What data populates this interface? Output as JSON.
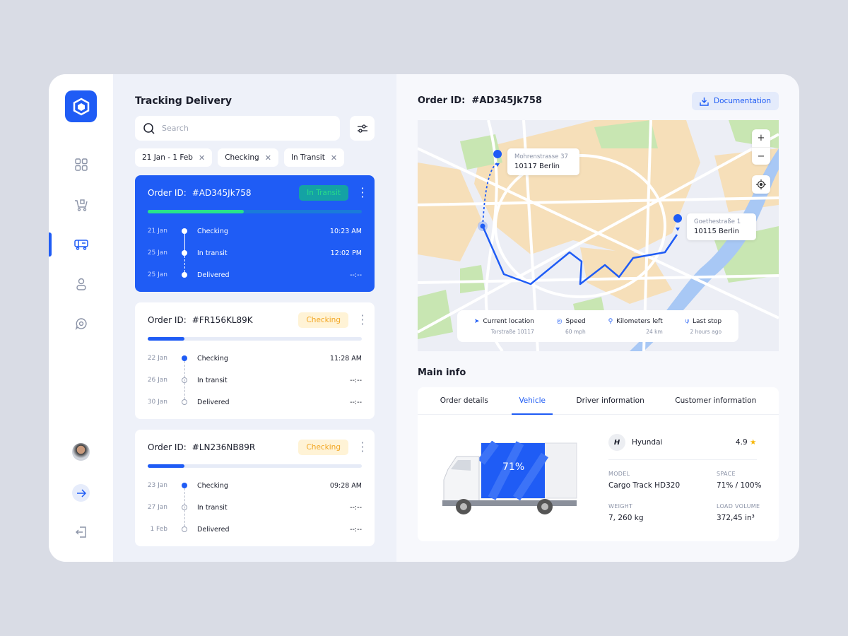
{
  "sidebar": {
    "items": [
      "dashboard",
      "cart",
      "delivery",
      "profile",
      "support"
    ],
    "active": "delivery"
  },
  "tracking": {
    "title": "Tracking Delivery",
    "search_placeholder": "Search",
    "chips": [
      "21 Jan - 1 Feb",
      "Checking",
      "In Transit"
    ],
    "orders": [
      {
        "label": "Order ID:",
        "id": "#AD345Jk758",
        "status": "In Transit",
        "progress": 45,
        "steps": [
          {
            "date": "21 Jan",
            "name": "Checking",
            "time": "10:23 AM"
          },
          {
            "date": "25 Jan",
            "name": "In transit",
            "time": "12:02 PM"
          },
          {
            "date": "25 Jan",
            "name": "Delivered",
            "time": "--:--"
          }
        ]
      },
      {
        "label": "Order ID:",
        "id": "#FR156KL89K",
        "status": "Checking",
        "progress": 17,
        "steps": [
          {
            "date": "22 Jan",
            "name": "Checking",
            "time": "11:28 AM"
          },
          {
            "date": "26 Jan",
            "name": "In transit",
            "time": "--:--"
          },
          {
            "date": "30 Jan",
            "name": "Delivered",
            "time": "--:--"
          }
        ]
      },
      {
        "label": "Order ID:",
        "id": "#LN236NB89R",
        "status": "Checking",
        "progress": 17,
        "steps": [
          {
            "date": "23 Jan",
            "name": "Checking",
            "time": "09:28 AM"
          },
          {
            "date": "27 Jan",
            "name": "In transit",
            "time": "--:--"
          },
          {
            "date": "1 Feb",
            "name": "Delivered",
            "time": "--:--"
          }
        ]
      }
    ]
  },
  "detail": {
    "label": "Order ID:",
    "id": "#AD345Jk758",
    "doc_button": "Documentation",
    "map": {
      "origin": {
        "street": "Mohrenstrasse 37",
        "city": "10117 Berlin"
      },
      "destination": {
        "street": "Goethestraße 1",
        "city": "10115 Berlin"
      },
      "zoom_in": "+",
      "zoom_out": "−"
    },
    "stats": [
      {
        "title": "Current location",
        "value": "Torstraße 10117"
      },
      {
        "title": "Speed",
        "value": "60 mph"
      },
      {
        "title": "Kilometers left",
        "value": "24 km"
      },
      {
        "title": "Last stop",
        "value": "2 hours ago"
      }
    ],
    "main_info_title": "Main info",
    "tabs": [
      "Order details",
      "Vehicle",
      "Driver information",
      "Customer information"
    ],
    "active_tab": "Vehicle",
    "vehicle": {
      "load_percent": "71%",
      "brand": "Hyundai",
      "rating": "4.9",
      "model_label": "MODEL",
      "model": "Cargo Track HD320",
      "space_label": "SPACE",
      "space": "71% / 100%",
      "weight_label": "WEIGHT",
      "weight": "7, 260 kg",
      "volume_label": "LOAD VOLUME",
      "volume": "372,45 in³"
    }
  },
  "colors": {
    "accent": "#1f5cf5",
    "progress_active": "#28e38b",
    "checking": "#f2a623",
    "star": "#f7b500"
  }
}
